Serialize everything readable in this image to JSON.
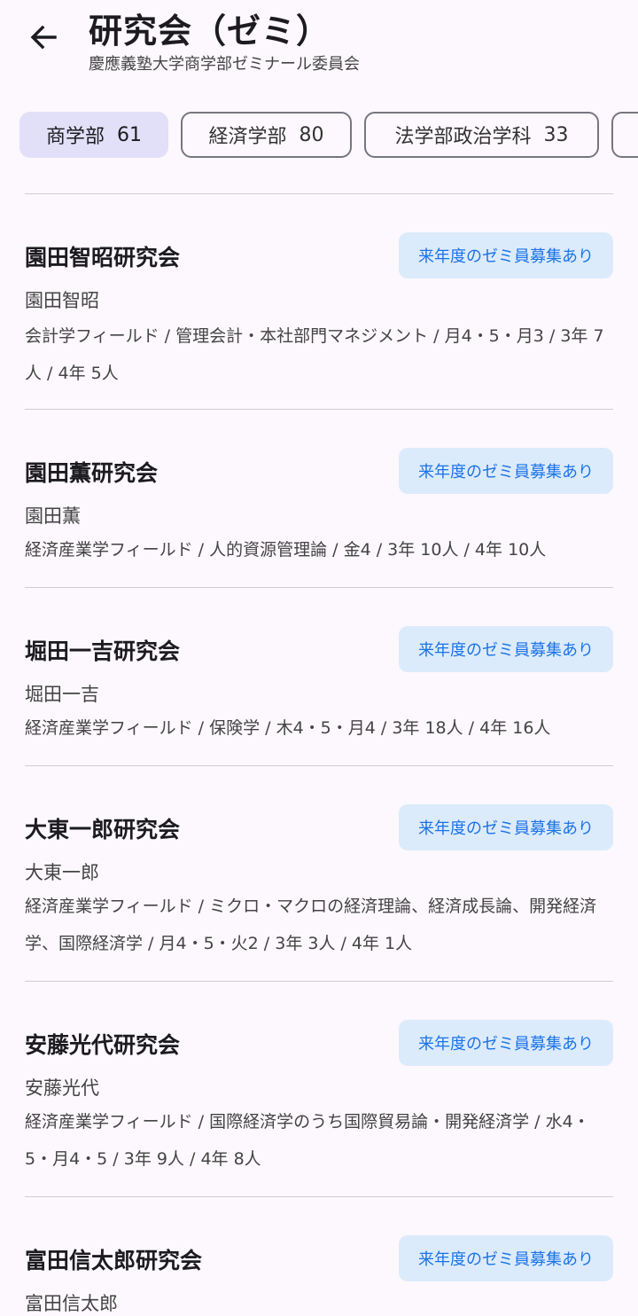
{
  "header": {
    "title": "研究会（ゼミ）",
    "subtitle": "慶應義塾大学商学部ゼミナール委員会"
  },
  "tabs": [
    {
      "label": "商学部",
      "count": "61",
      "selected": true
    },
    {
      "label": "経済学部",
      "count": "80",
      "selected": false
    },
    {
      "label": "法学部政治学科",
      "count": "33",
      "selected": false
    }
  ],
  "seminars": [
    {
      "name": "園田智昭研究会",
      "badge": "来年度のゼミ員募集あり",
      "professor": "園田智昭",
      "details": "会計学フィールド / 管理会計・本社部門マネジメント / 月4・5・月3 / 3年 7人 / 4年 5人"
    },
    {
      "name": "園田薫研究会",
      "badge": "来年度のゼミ員募集あり",
      "professor": "園田薫",
      "details": "経済産業学フィールド / 人的資源管理論 / 金4 / 3年 10人 / 4年 10人"
    },
    {
      "name": "堀田一吉研究会",
      "badge": "来年度のゼミ員募集あり",
      "professor": "堀田一吉",
      "details": "経済産業学フィールド / 保険学 / 木4・5・月4 / 3年 18人 / 4年 16人"
    },
    {
      "name": "大東一郎研究会",
      "badge": "来年度のゼミ員募集あり",
      "professor": "大東一郎",
      "details": "経済産業学フィールド / ミクロ・マクロの経済理論、経済成長論、開発経済学、国際経済学 / 月4・5・火2 / 3年 3人 / 4年 1人"
    },
    {
      "name": "安藤光代研究会",
      "badge": "来年度のゼミ員募集あり",
      "professor": "安藤光代",
      "details": "経済産業学フィールド / 国際経済学のうち国際貿易論・開発経済学 / 水4・5・月4・5 / 3年 9人 / 4年 8人"
    },
    {
      "name": "富田信太郎研究会",
      "badge": "来年度のゼミ員募集あり",
      "professor": "富田信太郎",
      "details": ""
    }
  ]
}
